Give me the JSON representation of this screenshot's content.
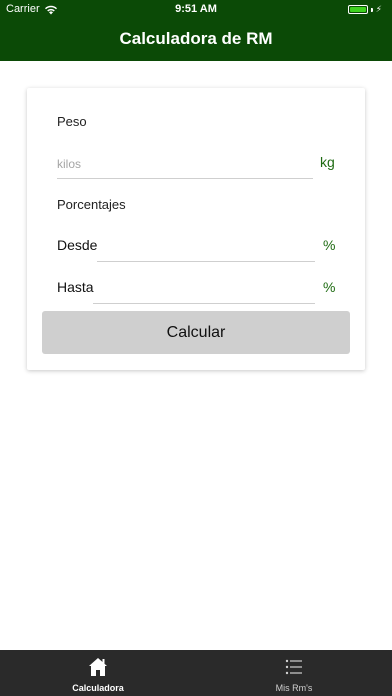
{
  "status_bar": {
    "carrier": "Carrier",
    "time": "9:51 AM",
    "wifi_icon": "wifi-icon",
    "battery_icon": "battery-icon",
    "battery_color": "#3fd21f"
  },
  "header": {
    "title": "Calculadora de RM",
    "background": "#0b4a06"
  },
  "form": {
    "peso_label": "Peso",
    "peso_placeholder": "kilos",
    "peso_unit": "kg",
    "porcentajes_label": "Porcentajes",
    "desde_label": "Desde",
    "desde_unit": "%",
    "hasta_label": "Hasta",
    "hasta_unit": "%",
    "calcular_label": "Calcular",
    "accent": "#1e6b12"
  },
  "tabbar": {
    "tabs": [
      {
        "label": "Calculadora",
        "icon": "home-icon",
        "active": true
      },
      {
        "label": "Mis Rm's",
        "icon": "list-icon",
        "active": false
      }
    ]
  }
}
